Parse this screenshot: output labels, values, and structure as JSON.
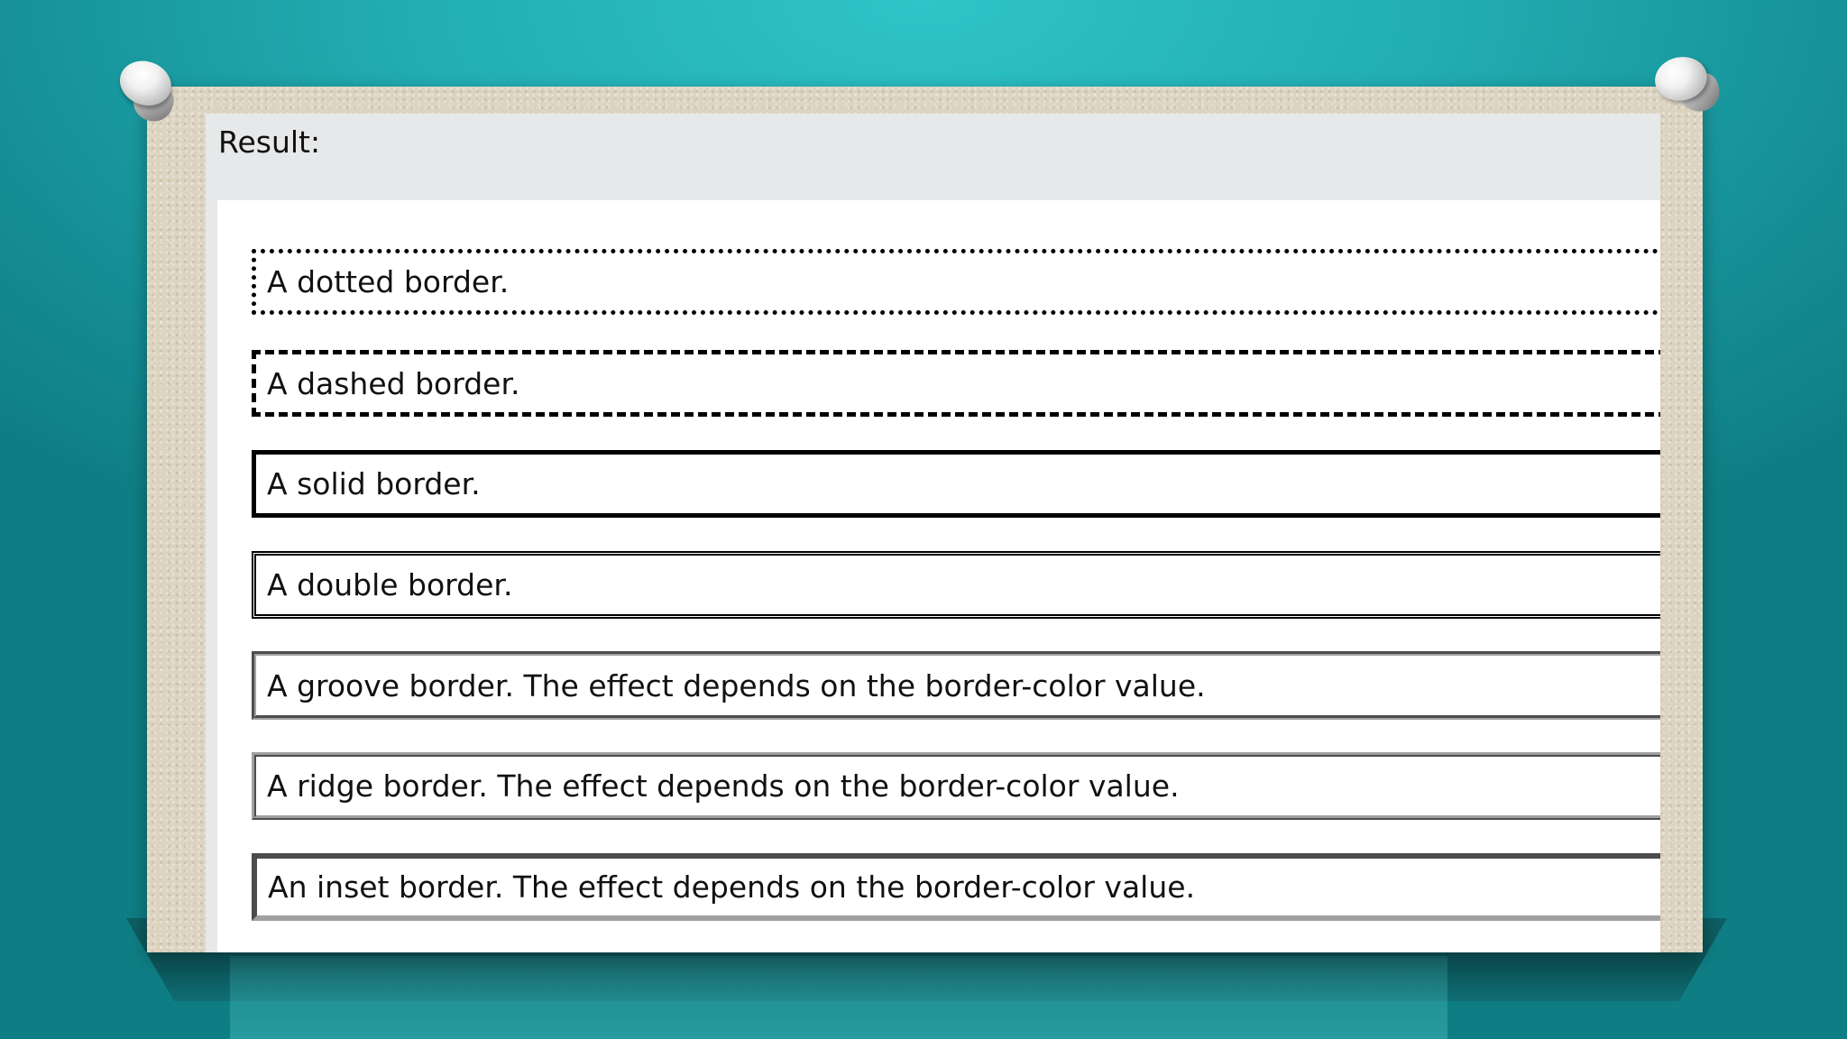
{
  "panel": {
    "heading": "Result:"
  },
  "borders": [
    {
      "style": "dotted",
      "text": "A dotted border."
    },
    {
      "style": "dashed",
      "text": "A dashed border."
    },
    {
      "style": "solid",
      "text": "A solid border."
    },
    {
      "style": "double",
      "text": "A double border."
    },
    {
      "style": "groove",
      "text": "A groove border. The effect depends on the border-color value."
    },
    {
      "style": "ridge",
      "text": "A ridge border. The effect depends on the border-color value."
    },
    {
      "style": "inset",
      "text": "An inset border. The effect depends on the border-color value."
    }
  ],
  "colors": {
    "background": "#22aeb3",
    "board": "#dcd3c0",
    "panel": "#e7e8e9",
    "content": "#ffffff",
    "border_dark": "#000000",
    "border_gray": "#a0a0a0"
  },
  "icons": [
    "pushpin-icon",
    "pushpin-icon"
  ]
}
